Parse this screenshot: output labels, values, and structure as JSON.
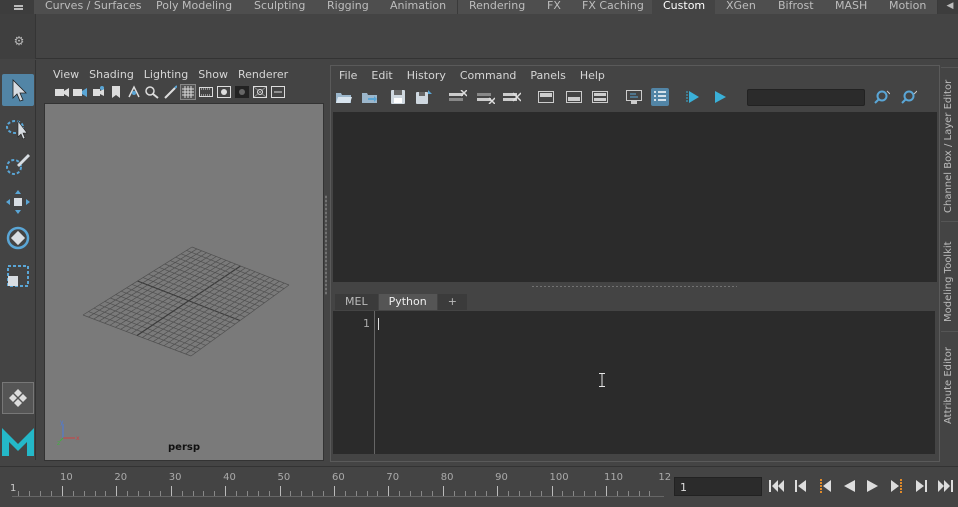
{
  "shelf": {
    "tabs": [
      {
        "label": "Curves / Surfaces",
        "active": false
      },
      {
        "label": "Poly Modeling",
        "active": false
      },
      {
        "label": "Sculpting",
        "active": false
      },
      {
        "label": "Rigging",
        "active": false
      },
      {
        "label": "Animation",
        "active": false
      },
      {
        "label": "Rendering",
        "active": false
      },
      {
        "label": "FX",
        "active": false
      },
      {
        "label": "FX Caching",
        "active": false
      },
      {
        "label": "Custom",
        "active": true
      },
      {
        "label": "XGen",
        "active": false
      },
      {
        "label": "Bifrost",
        "active": false
      },
      {
        "label": "MASH",
        "active": false
      },
      {
        "label": "Motion",
        "active": false
      }
    ],
    "overflow_icon": "chevron-left-icon",
    "settings_icon": "gear-icon"
  },
  "toolbox": {
    "tools": [
      "select-arrow-icon",
      "lasso-select-icon",
      "paint-select-icon",
      "move-tool-icon",
      "rotate-tool-icon",
      "scale-tool-icon"
    ],
    "bottom_icons": [
      "quad-layout-icon",
      "maya-logo-icon"
    ]
  },
  "viewport": {
    "menus": [
      "View",
      "Shading",
      "Lighting",
      "Show",
      "Renderer"
    ],
    "icons": [
      "camera-icon",
      "camera-attributes-icon",
      "bookmark-icon",
      "image-plane-icon",
      "2d-pan-icon",
      "grease-pencil-icon",
      "grid-icon",
      "film-gate-icon",
      "resolution-gate-icon",
      "gate-mask-icon",
      "field-chart-icon",
      "safe-action-icon",
      "safe-title-icon"
    ],
    "camera_label": "persp",
    "background_color": "#7a7a7a",
    "grid_color": "#505050"
  },
  "script_editor": {
    "menus": [
      "File",
      "Edit",
      "History",
      "Command",
      "Panels",
      "Help"
    ],
    "toolbar_icons": [
      "open-script-icon",
      "source-script-icon",
      "save-script-icon",
      "save-to-shelf-icon",
      "clear-history-icon",
      "clear-input-icon",
      "clear-all-icon",
      "show-history-icon",
      "show-input-icon",
      "show-both-icon",
      "echo-all-commands-icon",
      "show-line-numbers-icon",
      "execute-all-icon",
      "execute-icon",
      "search-icon",
      "search-next-icon"
    ],
    "search_placeholder": "",
    "tabs": [
      {
        "label": "MEL",
        "active": false
      },
      {
        "label": "Python",
        "active": true
      },
      {
        "label": "+",
        "active": false
      }
    ],
    "line_number": "1",
    "accent_color": "#5285a6"
  },
  "right_panel": {
    "tabs": [
      "Channel Box / Layer Editor",
      "Modeling Toolkit",
      "Attribute Editor"
    ]
  },
  "timeline": {
    "ticks": [
      "1",
      "10",
      "20",
      "30",
      "40",
      "50",
      "60",
      "70",
      "80",
      "90",
      "100",
      "110",
      "12"
    ],
    "range_start": "1",
    "current_time": "1",
    "playback_icons": [
      "go-to-start-icon",
      "step-back-frame-icon",
      "step-back-key-icon",
      "play-backwards-icon",
      "play-forwards-icon",
      "step-forward-key-icon",
      "step-forward-frame-icon",
      "go-to-end-icon"
    ]
  }
}
